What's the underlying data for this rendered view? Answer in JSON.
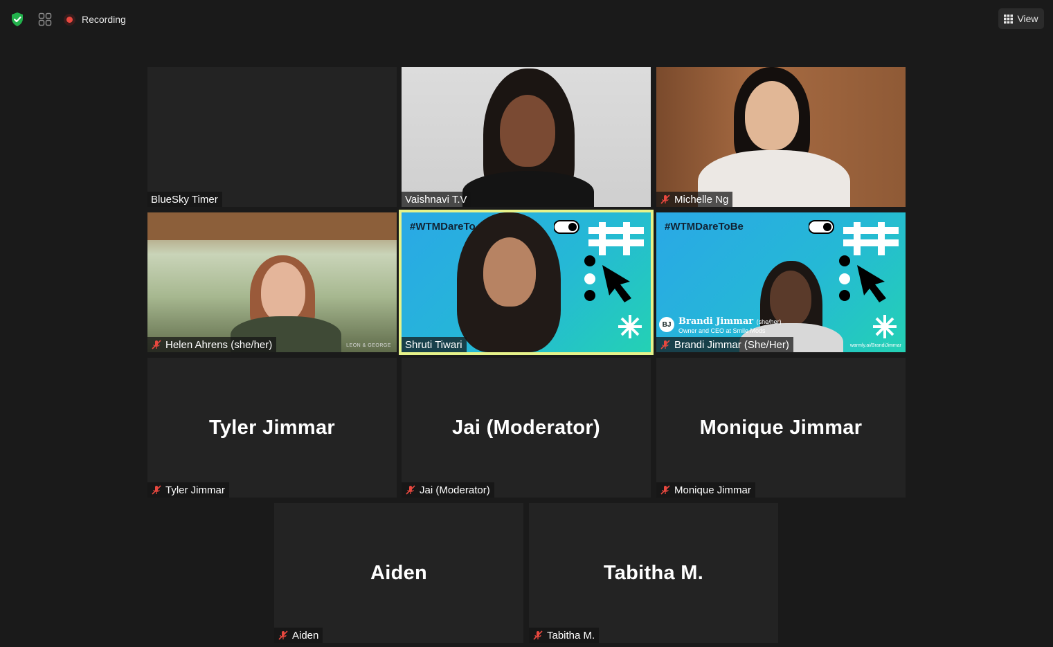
{
  "topbar": {
    "shield_icon": "shield-check-icon",
    "gallery_icon": "gallery-grid-icon",
    "recording_label": "Recording",
    "view_label": "View",
    "accent_green": "#22b14c",
    "record_red": "#e8483f"
  },
  "tiles": {
    "bluesky": {
      "name": "BlueSky Timer"
    },
    "vaishnavi": {
      "name": "Vaishnavi T.V"
    },
    "michelle": {
      "name": "Michelle Ng",
      "muted": true
    },
    "helen": {
      "name": "Helen Ahrens (she/her)",
      "muted": true,
      "watermark": "LEON & GEORGE"
    },
    "shruti": {
      "name": "Shruti Tiwari",
      "speaking": true,
      "hashtag": "#WTMDareTo"
    },
    "brandi": {
      "name": "Brandi Jimmar (She/Her)",
      "muted": true,
      "hashtag": "#WTMDareToBe",
      "badge": "BJ",
      "lower_third_name": "Brandi Jimmar",
      "lower_third_pronoun": "(she/her)",
      "lower_third_title": "Owner and CEO at Smile Mods",
      "url": "warmly.ai/BrandiJimmar"
    },
    "tyler": {
      "display": "Tyler Jimmar",
      "name": "Tyler Jimmar",
      "muted": true
    },
    "jai": {
      "display": "Jai (Moderator)",
      "name": "Jai (Moderator)",
      "muted": true
    },
    "monique": {
      "display": "Monique Jimmar",
      "name": "Monique Jimmar",
      "muted": true
    },
    "aiden": {
      "display": "Aiden",
      "name": "Aiden",
      "muted": true
    },
    "tabitha": {
      "display": "Tabitha M.",
      "name": "Tabitha M.",
      "muted": true
    }
  },
  "colors": {
    "speaking_border": "#e6f28a",
    "muted_icon": "#e8483f",
    "tile_bg": "#232323",
    "app_bg": "#1a1a1a"
  }
}
